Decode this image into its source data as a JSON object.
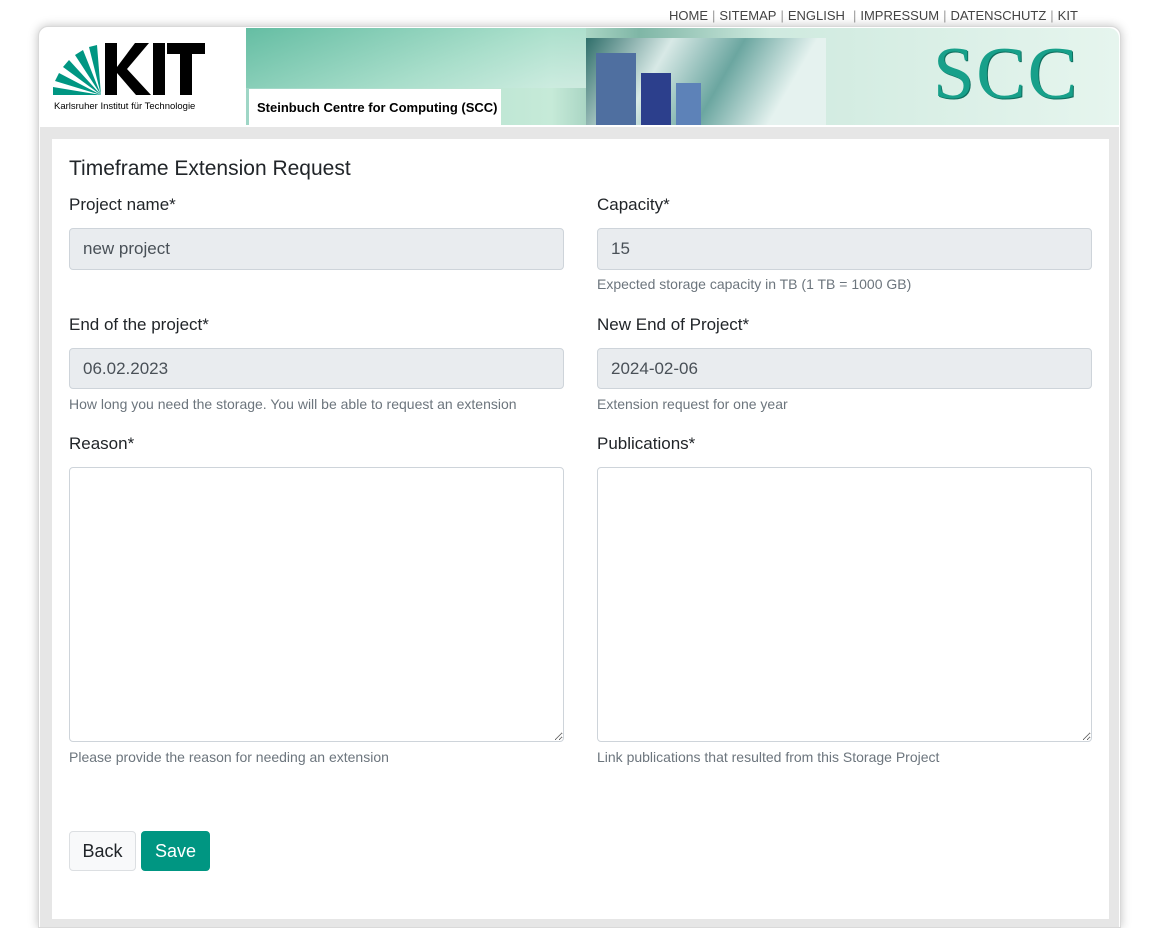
{
  "top_nav": {
    "items": [
      "HOME",
      "SITEMAP",
      "ENGLISH",
      "IMPRESSUM",
      "DATENSCHUTZ",
      "KIT"
    ]
  },
  "header": {
    "logo_text": "KIT",
    "logo_caption": "Karlsruher Institut für Technologie",
    "subtitle": "Steinbuch Centre for Computing (SCC)",
    "banner_logo": "SCC"
  },
  "form": {
    "title": "Timeframe Extension Request",
    "project_name": {
      "label": "Project name*",
      "value": "new project"
    },
    "capacity": {
      "label": "Capacity*",
      "value": "15",
      "help": "Expected storage capacity in TB (1 TB = 1000 GB)"
    },
    "end_of_project": {
      "label": "End of the project*",
      "value": "06.02.2023",
      "help": "How long you need the storage. You will be able to request an extension"
    },
    "new_end_of_project": {
      "label": "New End of Project*",
      "value": "2024-02-06",
      "help": "Extension request for one year"
    },
    "reason": {
      "label": "Reason*",
      "value": "",
      "help": "Please provide the reason for needing an extension"
    },
    "publications": {
      "label": "Publications*",
      "value": "",
      "help": "Link publications that resulted from this Storage Project"
    }
  },
  "actions": {
    "back_label": "Back",
    "save_label": "Save"
  },
  "colors": {
    "accent": "#009682",
    "input_readonly_bg": "#e9ecef",
    "help_text": "#6c757d"
  }
}
